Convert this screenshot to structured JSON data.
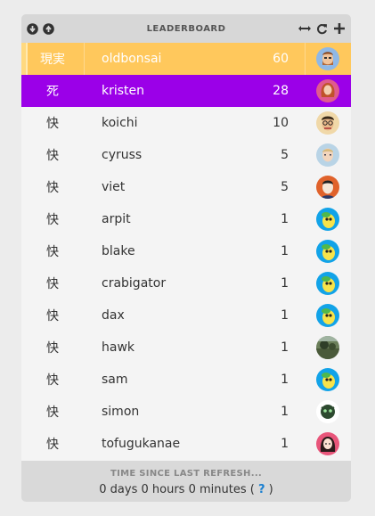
{
  "header": {
    "title": "LEADERBOARD",
    "left_icons": [
      "download-icon",
      "upload-icon"
    ],
    "right_icons": [
      "resize-icon",
      "refresh-icon",
      "plus-icon"
    ]
  },
  "rows": [
    {
      "kanji": "現実",
      "name": "oldbonsai",
      "score": "60",
      "avatar": "bearded-man-avatar",
      "color": "#ffc85c"
    },
    {
      "kanji": "死",
      "name": "kristen",
      "score": "28",
      "avatar": "red-hair-woman-avatar",
      "color": "#9b00e8"
    },
    {
      "kanji": "快",
      "name": "koichi",
      "score": "10",
      "avatar": "man-glasses-avatar"
    },
    {
      "kanji": "快",
      "name": "cyruss",
      "score": "5",
      "avatar": "man-light-avatar"
    },
    {
      "kanji": "快",
      "name": "viet",
      "score": "5",
      "avatar": "man-orange-bg-avatar"
    },
    {
      "kanji": "快",
      "name": "arpit",
      "score": "1",
      "avatar": "crabigator-avatar"
    },
    {
      "kanji": "快",
      "name": "blake",
      "score": "1",
      "avatar": "crabigator-avatar"
    },
    {
      "kanji": "快",
      "name": "crabigator",
      "score": "1",
      "avatar": "crabigator-avatar"
    },
    {
      "kanji": "快",
      "name": "dax",
      "score": "1",
      "avatar": "crabigator-avatar"
    },
    {
      "kanji": "快",
      "name": "hawk",
      "score": "1",
      "avatar": "landscape-avatar"
    },
    {
      "kanji": "快",
      "name": "sam",
      "score": "1",
      "avatar": "crabigator-avatar"
    },
    {
      "kanji": "快",
      "name": "simon",
      "score": "1",
      "avatar": "creature-avatar"
    },
    {
      "kanji": "快",
      "name": "tofugukanae",
      "score": "1",
      "avatar": "girl-avatar"
    }
  ],
  "footer": {
    "label": "TIME SINCE LAST REFRESH...",
    "time": "0 days 0 hours 0 minutes (",
    "help": "?",
    "close": ")"
  }
}
